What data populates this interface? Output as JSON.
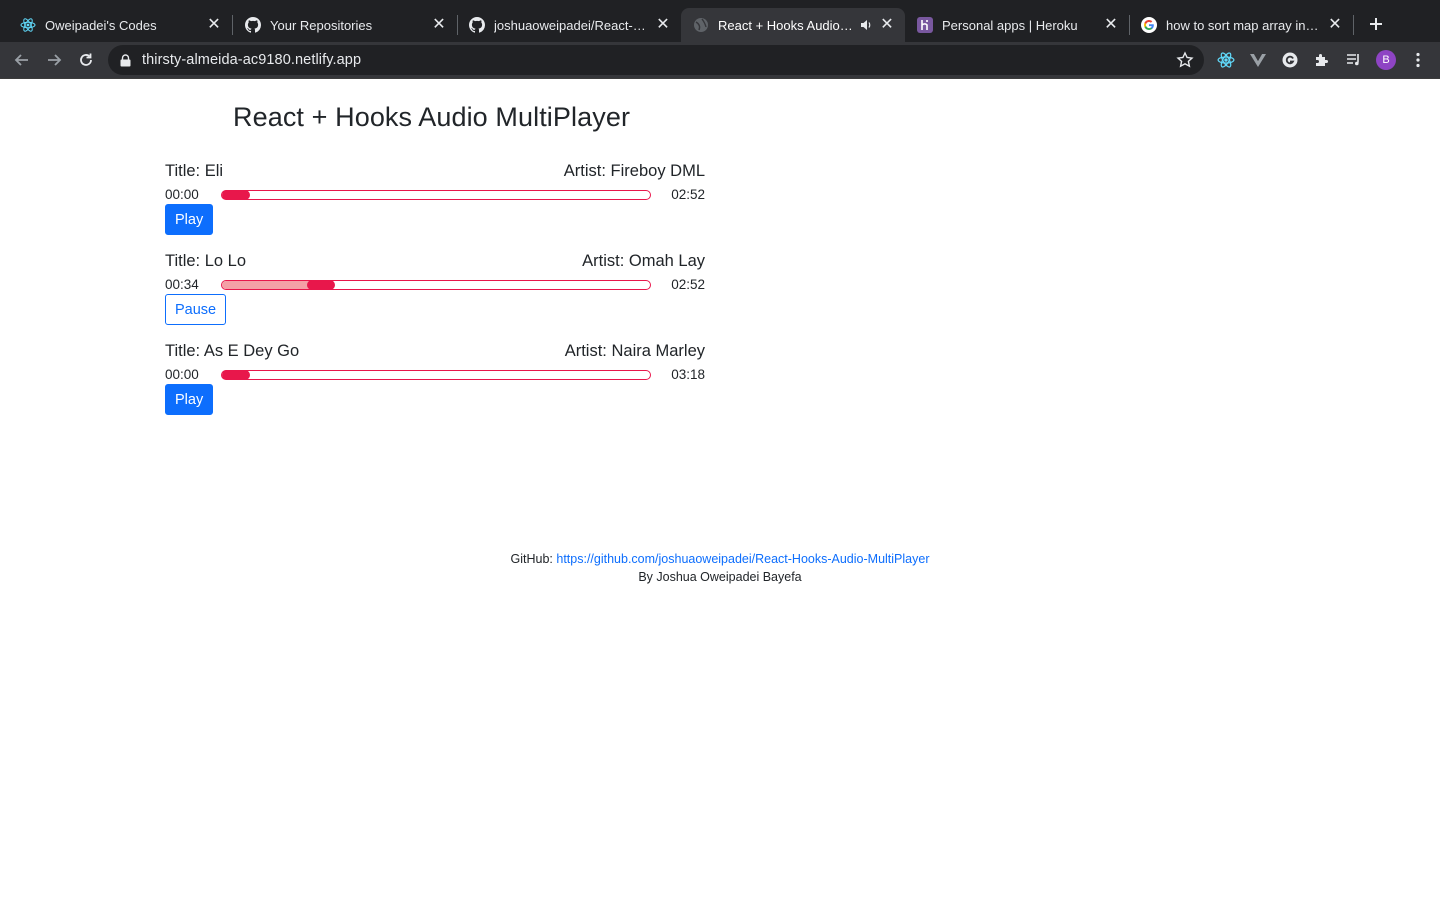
{
  "browser": {
    "tabs": [
      {
        "title": "Oweipadei's Codes",
        "icon": "react-icon",
        "active": false
      },
      {
        "title": "Your Repositories",
        "icon": "github-icon",
        "active": false
      },
      {
        "title": "joshuaoweipadei/React-Hoo",
        "icon": "github-icon",
        "active": false
      },
      {
        "title": "React + Hooks Audio Mu",
        "icon": "globe-icon",
        "active": true,
        "audio": true
      },
      {
        "title": "Personal apps | Heroku",
        "icon": "heroku-icon",
        "active": false
      },
      {
        "title": "how to sort map array in des",
        "icon": "google-icon",
        "active": false
      }
    ],
    "url": "thirsty-almeida-ac9180.netlify.app",
    "profile_initial": "B",
    "colors": {
      "chrome_dark": "#202124",
      "chrome_tab": "#35363a",
      "profile": "#8e44c4"
    }
  },
  "app": {
    "heading": "React + Hooks Audio MultiPlayer",
    "tracks": [
      {
        "title": "Title: Eli",
        "artist": "Artist: Fireboy DML",
        "current_time": "00:00",
        "duration": "02:52",
        "progress_fraction": 0.0,
        "button": "Play",
        "playing": false
      },
      {
        "title": "Title: Lo Lo",
        "artist": "Artist: Omah Lay",
        "current_time": "00:34",
        "duration": "02:52",
        "progress_fraction": 0.198,
        "button": "Pause",
        "playing": true
      },
      {
        "title": "Title: As E Dey Go",
        "artist": "Artist: Naira Marley",
        "current_time": "00:00",
        "duration": "03:18",
        "progress_fraction": 0.0,
        "button": "Play",
        "playing": false
      }
    ],
    "footer": {
      "github_label": "GitHub:",
      "github_link": "https://github.com/joshuaoweipadei/React-Hooks-Audio-MultiPlayer",
      "byline": "By Joshua Oweipadei Bayefa"
    },
    "colors": {
      "accent": "#0d6efd",
      "progress": "#e8174b",
      "progress_fill": "#f4a0a6"
    }
  }
}
